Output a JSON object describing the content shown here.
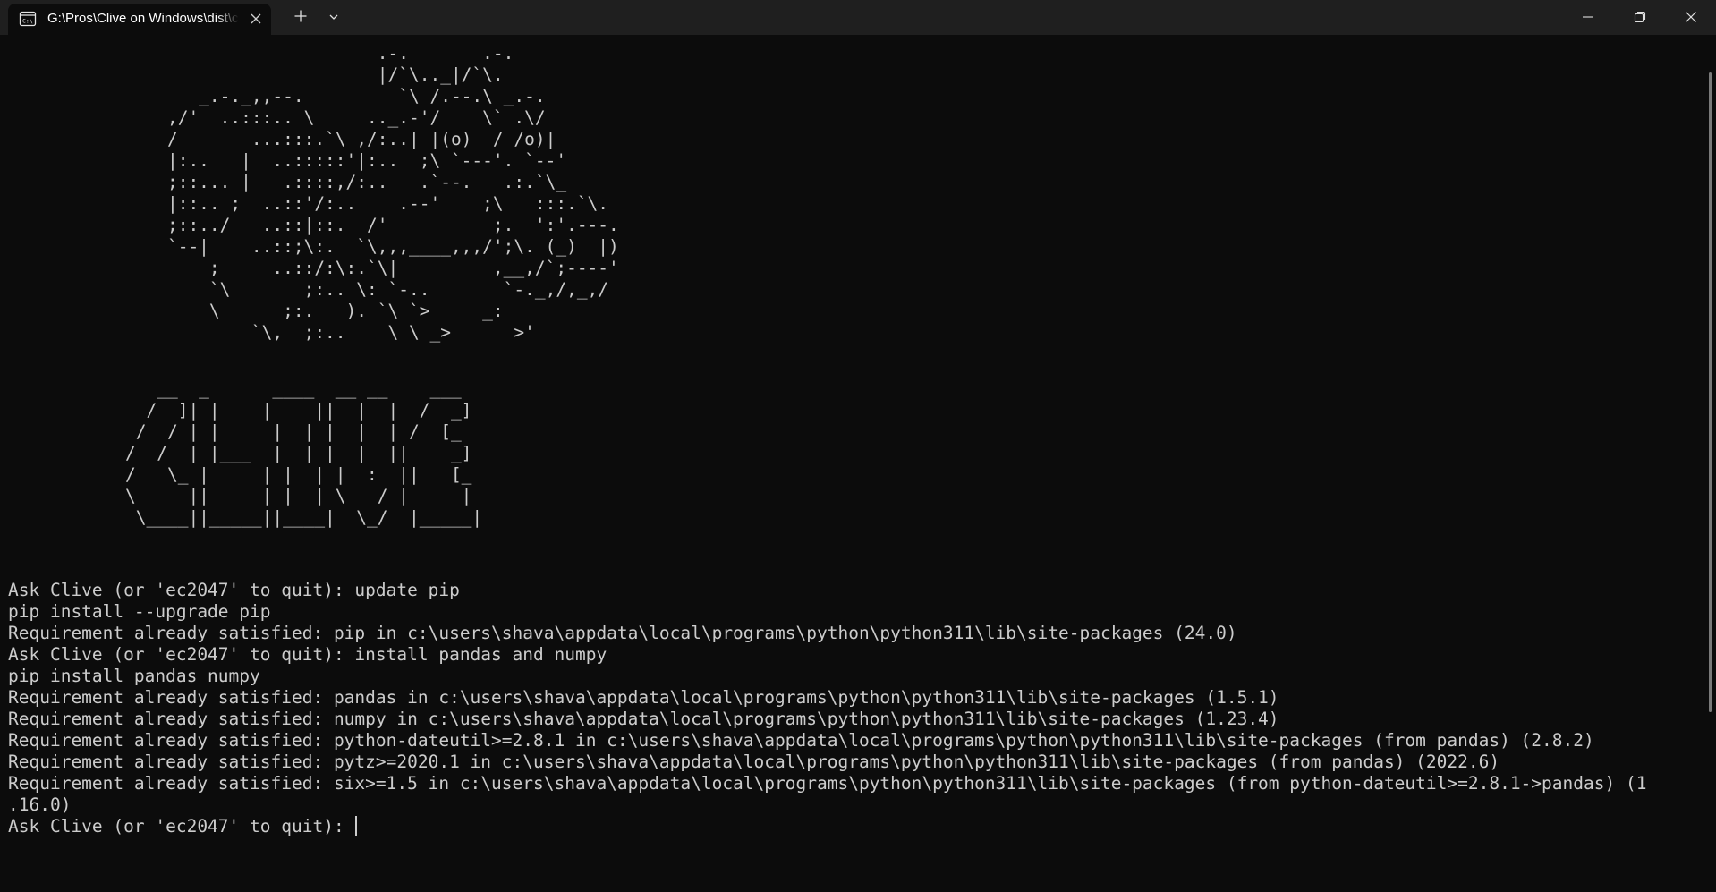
{
  "tab": {
    "title": "G:\\Pros\\Clive on Windows\\dist\\clive.exe",
    "icon": "terminal-icon"
  },
  "titlebar": {
    "new_tab_icon": "plus-icon",
    "dropdown_icon": "chevron-down-icon",
    "minimize_icon": "minimize-icon",
    "maximize_icon": "restore-icon",
    "close_icon": "close-icon"
  },
  "terminal": {
    "background": "#0c0c0c",
    "foreground": "#cccccc",
    "ascii_art": "                        .-.       .-.\n                        |/`\\.._|/`\\.\n       _.-._,,--.         `\\ /.--.\\ _.-.\n    ,/'  ..:::.. \\     .._.-'/    \\` .\\/\n    /       ...:::.`\\ ,/:..| |(o)  / /o)|\n    |:..   |  ..:::::'|:..  ;\\ `---'. `--'\n    ;::... |   .::::,/:..   .`--.   .:.`\\_\n    |::.. ;  ..::'/:..    .--'    ;\\   :::.`\\.\n    ;::../   ..::|::.  /'          ;.  ':'.---.\n    `--|    ..::;\\:.  `\\,,,____,,,/';\\. (_)  |)\n        ;     ..::/:\\:.`\\|         ,__,/`;----'\n        `\\       ;:.. \\: `-..       `-._,/,_,/\n        \\      ;:.   ). `\\ `>     _:\n            `\\,  ;:..    \\ \\ _>      >'",
    "logo_art": "   __  _      ____  __ __    ___\n  /  ]| |    |    ||  |  |  /  _]\n /  / | |     |  | |  |  | /  [_\n/  /  | |___  |  | |  |  ||    _]\n/   \\_ |     | |  | |  :  ||   [_\n\\     ||     | |  | \\   / |     |\n \\____||_____||____|  \\_/  |_____|",
    "lines": [
      "Ask Clive (or 'ec2047' to quit): update pip",
      "pip install --upgrade pip",
      "Requirement already satisfied: pip in c:\\users\\shava\\appdata\\local\\programs\\python\\python311\\lib\\site-packages (24.0)",
      "Ask Clive (or 'ec2047' to quit): install pandas and numpy",
      "pip install pandas numpy",
      "Requirement already satisfied: pandas in c:\\users\\shava\\appdata\\local\\programs\\python\\python311\\lib\\site-packages (1.5.1)",
      "Requirement already satisfied: numpy in c:\\users\\shava\\appdata\\local\\programs\\python\\python311\\lib\\site-packages (1.23.4)",
      "Requirement already satisfied: python-dateutil>=2.8.1 in c:\\users\\shava\\appdata\\local\\programs\\python\\python311\\lib\\site-packages (from pandas) (2.8.2)",
      "Requirement already satisfied: pytz>=2020.1 in c:\\users\\shava\\appdata\\local\\programs\\python\\python311\\lib\\site-packages (from pandas) (2022.6)",
      "Requirement already satisfied: six>=1.5 in c:\\users\\shava\\appdata\\local\\programs\\python\\python311\\lib\\site-packages (from python-dateutil>=2.8.1->pandas) (1",
      ".16.0)"
    ],
    "prompt": "Ask Clive (or 'ec2047' to quit): "
  }
}
